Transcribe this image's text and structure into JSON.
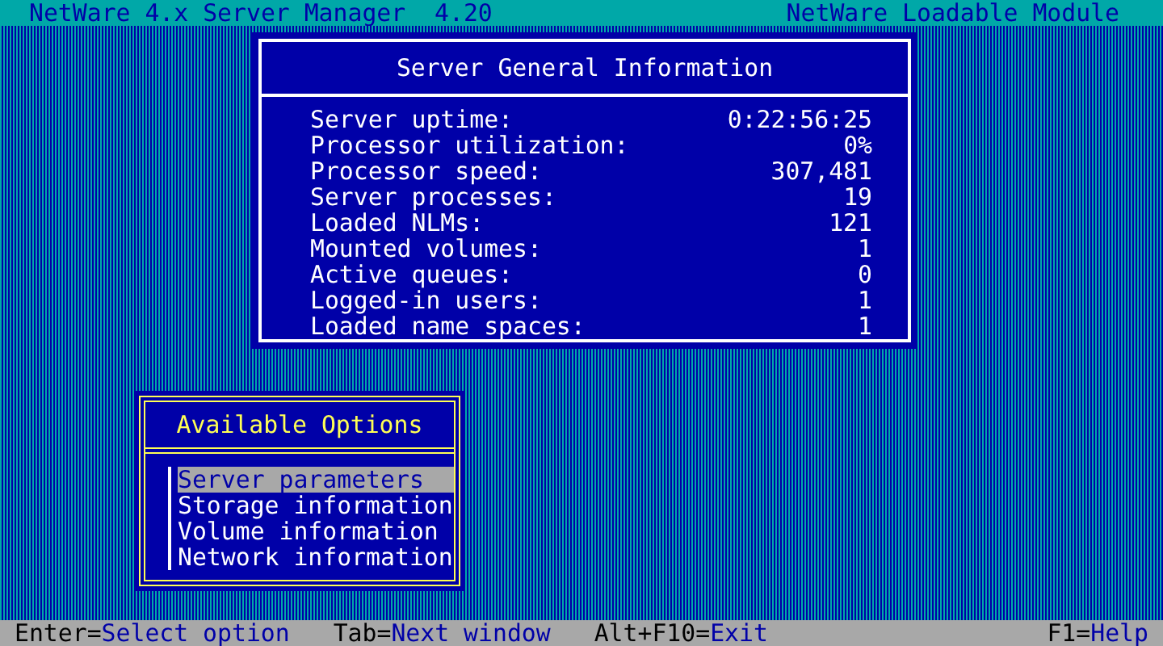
{
  "header": {
    "title": "NetWare 4.x Server Manager  4.20",
    "module": "NetWare Loadable Module"
  },
  "info_window": {
    "title": "Server General Information",
    "rows": [
      {
        "label": "Server uptime:",
        "value": "0:22:56:25"
      },
      {
        "label": "Processor utilization:",
        "value": "0%"
      },
      {
        "label": "Processor speed:",
        "value": "307,481"
      },
      {
        "label": "Server processes:",
        "value": "19"
      },
      {
        "label": "Loaded NLMs:",
        "value": "121"
      },
      {
        "label": "Mounted volumes:",
        "value": "1"
      },
      {
        "label": "Active queues:",
        "value": "0"
      },
      {
        "label": "Logged-in users:",
        "value": "1"
      },
      {
        "label": "Loaded name spaces:",
        "value": "1"
      }
    ]
  },
  "options_window": {
    "title": "Available Options",
    "items": [
      {
        "label": "Server parameters",
        "selected": true
      },
      {
        "label": "Storage information",
        "selected": false
      },
      {
        "label": "Volume information",
        "selected": false
      },
      {
        "label": "Network information",
        "selected": false
      }
    ]
  },
  "status_bar": {
    "hints": [
      {
        "key": "Enter=",
        "action": "Select option"
      },
      {
        "key": "Tab=",
        "action": "Next window"
      },
      {
        "key": "Alt+F10=",
        "action": "Exit"
      },
      {
        "key": "F1=",
        "action": "Help"
      }
    ]
  }
}
